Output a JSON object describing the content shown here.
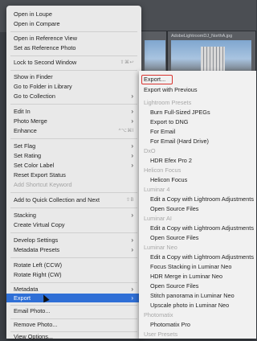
{
  "background": {
    "thumbnail_name": "AdobeLightroomDJ_NorthA.jpg"
  },
  "menu": {
    "items": [
      {
        "label": "Open in Loupe"
      },
      {
        "label": "Open in Compare"
      },
      {
        "label": "Open in Reference View"
      },
      {
        "label": "Set as Reference Photo"
      },
      {
        "label": "Lock to Second Window",
        "shortcut": "⇧⌘↩"
      },
      {
        "label": "Show in Finder"
      },
      {
        "label": "Go to Folder in Library"
      },
      {
        "label": "Go to Collection"
      },
      {
        "label": "Edit In"
      },
      {
        "label": "Photo Merge"
      },
      {
        "label": "Enhance",
        "shortcut": "^⌥⌘I"
      },
      {
        "label": "Set Flag"
      },
      {
        "label": "Set Rating"
      },
      {
        "label": "Set Color Label"
      },
      {
        "label": "Reset Export Status"
      },
      {
        "label": "Add Shortcut Keyword"
      },
      {
        "label": "Add to Quick Collection and Next",
        "shortcut": "⇧B"
      },
      {
        "label": "Stacking"
      },
      {
        "label": "Create Virtual Copy"
      },
      {
        "label": "Develop Settings"
      },
      {
        "label": "Metadata Presets"
      },
      {
        "label": "Rotate Left (CCW)"
      },
      {
        "label": "Rotate Right (CW)"
      },
      {
        "label": "Metadata"
      },
      {
        "label": "Export"
      },
      {
        "label": "Email Photo..."
      },
      {
        "label": "Remove Photo..."
      },
      {
        "label": "View Options..."
      }
    ]
  },
  "submenu": {
    "items": [
      {
        "label": "Export..."
      },
      {
        "label": "Export with Previous"
      },
      {
        "label": "Lightroom Presets"
      },
      {
        "label": "Burn Full-Sized JPEGs"
      },
      {
        "label": "Export to DNG"
      },
      {
        "label": "For Email"
      },
      {
        "label": "For Email (Hard Drive)"
      },
      {
        "label": "DxO"
      },
      {
        "label": "HDR Efex Pro 2"
      },
      {
        "label": "Helicon Focus"
      },
      {
        "label": "Helicon Focus"
      },
      {
        "label": "Luminar 4"
      },
      {
        "label": "Edit a Copy with Lightroom Adjustments"
      },
      {
        "label": "Open Source Files"
      },
      {
        "label": "Luminar AI"
      },
      {
        "label": "Edit a Copy with Lightroom Adjustments"
      },
      {
        "label": "Open Source Files"
      },
      {
        "label": "Luminar Neo"
      },
      {
        "label": "Edit a Copy with Lightroom Adjustments"
      },
      {
        "label": "Focus Stacking in Luminar Neo"
      },
      {
        "label": "HDR Merge in Luminar Neo"
      },
      {
        "label": "Open Source Files"
      },
      {
        "label": "Stitch panorama in Luminar Neo"
      },
      {
        "label": "Upscale photo in Luminar Neo"
      },
      {
        "label": "Photomatix"
      },
      {
        "label": "Photomatix Pro"
      },
      {
        "label": "User Presets"
      }
    ]
  }
}
